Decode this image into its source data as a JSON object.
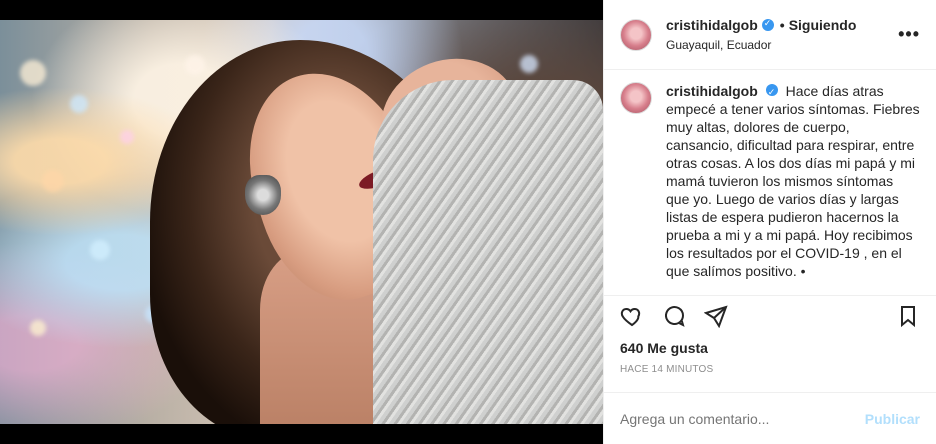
{
  "post": {
    "username": "cristihidalgob",
    "location": "Guayaquil, Ecuador",
    "follow_sep": "•",
    "follow_label": "Siguiendo",
    "more_icon": "more-dots-icon",
    "caption_user": "cristihidalgob",
    "caption_text": "Hace días atras empecé a tener varios síntomas. Fiebres muy altas, dolores de cuerpo, cansancio, dificultad para respirar, entre otras cosas. A los dos días mi papá y mi mamá tuvieron los mismos síntomas que yo. Luego de varios días y largas listas de espera pudieron hacernos la prueba a mi y a mi papá. Hoy recibimos los resultados por el COVID-19 , en el que salímos positivo. •",
    "likes": "640 Me gusta",
    "time": "Hace 14 minutos",
    "comment_placeholder": "Agrega un comentario...",
    "publish_label": "Publicar"
  },
  "colors": {
    "verified": "#3897f0",
    "publish": "#b2dffc",
    "muted": "#8e8e8e",
    "text": "#262626"
  },
  "icons": {
    "like": "heart-icon",
    "comment": "comment-icon",
    "share": "send-icon",
    "save": "bookmark-icon"
  }
}
